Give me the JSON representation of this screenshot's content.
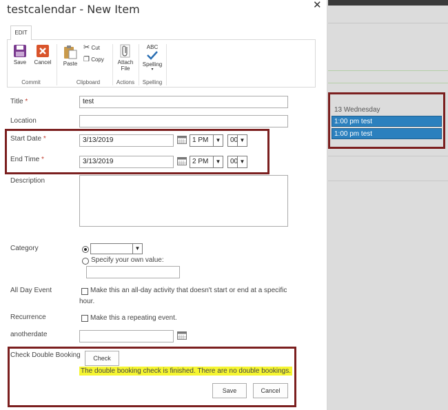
{
  "dialog": {
    "title": "testcalendar - New Item"
  },
  "ribbon": {
    "tab": "EDIT",
    "buttons": {
      "save": "Save",
      "cancel": "Cancel",
      "paste": "Paste",
      "cut": "Cut",
      "copy": "Copy",
      "attach_line1": "Attach",
      "attach_line2": "File",
      "spelling": "Spelling",
      "abc": "ABC"
    },
    "groups": {
      "commit": "Commit",
      "clipboard": "Clipboard",
      "actions": "Actions",
      "spelling": "Spelling"
    }
  },
  "form": {
    "title": {
      "label": "Title",
      "required": "*",
      "value": "test"
    },
    "location": {
      "label": "Location",
      "value": ""
    },
    "start": {
      "label": "Start Date",
      "required": "*",
      "date": "3/13/2019",
      "hour": "1 PM",
      "minute": "00"
    },
    "end": {
      "label": "End Time",
      "required": "*",
      "date": "3/13/2019",
      "hour": "2 PM",
      "minute": "00"
    },
    "description": {
      "label": "Description",
      "value": ""
    },
    "category": {
      "label": "Category",
      "selected": "",
      "own_value_label": "Specify your own value:",
      "own_value": ""
    },
    "all_day": {
      "label": "All Day Event",
      "text_line1": "Make this an all-day activity that doesn't start or end at a specific",
      "text_line2": "hour."
    },
    "recurrence": {
      "label": "Recurrence",
      "text": "Make this a repeating event."
    },
    "anotherdate": {
      "label": "anotherdate",
      "value": ""
    },
    "double_booking": {
      "label": "Check Double Booking",
      "check_button": "Check",
      "message": "The double booking check is finished. There are no double bookings."
    }
  },
  "footer": {
    "save": "Save",
    "cancel": "Cancel"
  },
  "calendar": {
    "day": "13 Wednesday",
    "events": [
      "1:00 pm test",
      "1:00 pm test"
    ],
    "event_color": "#2b80be"
  },
  "colors": {
    "highlight_border": "#7b1f1f",
    "message_highlight": "#f5f531"
  }
}
